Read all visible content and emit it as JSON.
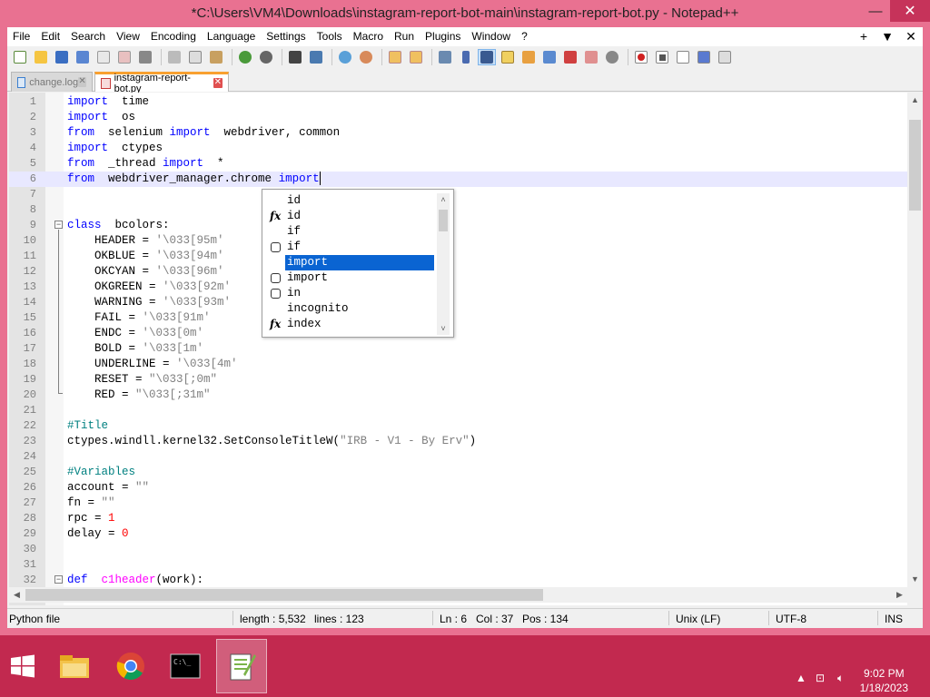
{
  "window": {
    "title": "*C:\\Users\\VM4\\Downloads\\instagram-report-bot-main\\instagram-report-bot.py - Notepad++",
    "minimize": "—",
    "close": "✕"
  },
  "menu": {
    "items": [
      "File",
      "Edit",
      "Search",
      "View",
      "Encoding",
      "Language",
      "Settings",
      "Tools",
      "Macro",
      "Run",
      "Plugins",
      "Window",
      "?"
    ],
    "right": [
      "+",
      "▼",
      "✕"
    ]
  },
  "toolbar": {
    "icons": [
      "new-file-icon",
      "open-file-icon",
      "save-icon",
      "save-all-icon",
      "close-icon",
      "close-all-icon",
      "print-icon",
      "cut-icon",
      "copy-icon",
      "paste-icon",
      "undo-icon",
      "redo-icon",
      "find-icon",
      "replace-icon",
      "zoom-in-icon",
      "zoom-out-icon",
      "sync-vertical-icon",
      "sync-horizontal-icon",
      "word-wrap-icon",
      "show-all-chars-icon",
      "indent-guide-icon",
      "udl-icon",
      "doc-map-icon",
      "function-list-icon",
      "folder-workspace-icon",
      "monitor-icon",
      "record-macro-icon",
      "stop-macro-icon",
      "play-macro-icon",
      "run-macro-multiple-icon",
      "save-macro-icon"
    ]
  },
  "tabs": [
    {
      "label": "change.log",
      "active": false
    },
    {
      "label": "instagram-report-bot.py",
      "active": true
    }
  ],
  "editor": {
    "lines": [
      {
        "n": "1",
        "parts": [
          [
            "kw2",
            "import"
          ],
          [
            "",
            "  time"
          ]
        ]
      },
      {
        "n": "2",
        "parts": [
          [
            "kw2",
            "import"
          ],
          [
            "",
            "  os"
          ]
        ]
      },
      {
        "n": "3",
        "parts": [
          [
            "kw2",
            "from"
          ],
          [
            "",
            "  selenium "
          ],
          [
            "kw2",
            "import"
          ],
          [
            "",
            "  webdriver, common"
          ]
        ]
      },
      {
        "n": "4",
        "parts": [
          [
            "kw2",
            "import"
          ],
          [
            "",
            "  ctypes"
          ]
        ]
      },
      {
        "n": "5",
        "parts": [
          [
            "kw2",
            "from"
          ],
          [
            "",
            "  _thread "
          ],
          [
            "kw2",
            "import"
          ],
          [
            "",
            "  *"
          ]
        ]
      },
      {
        "n": "6",
        "parts": [
          [
            "kw2",
            "from"
          ],
          [
            "",
            "  webdriver_manager.chrome "
          ],
          [
            "kw2",
            "import"
          ]
        ]
      },
      {
        "n": "7",
        "parts": []
      },
      {
        "n": "8",
        "parts": []
      },
      {
        "n": "9",
        "parts": [
          [
            "kw2",
            "class"
          ],
          [
            "",
            "  bcolors:"
          ]
        ]
      },
      {
        "n": "10",
        "parts": [
          [
            "",
            "    HEADER = "
          ],
          [
            "str",
            "'\\033[95m'"
          ]
        ]
      },
      {
        "n": "11",
        "parts": [
          [
            "",
            "    OKBLUE = "
          ],
          [
            "str",
            "'\\033[94m'"
          ]
        ]
      },
      {
        "n": "12",
        "parts": [
          [
            "",
            "    OKCYAN = "
          ],
          [
            "str",
            "'\\033[96m'"
          ]
        ]
      },
      {
        "n": "13",
        "parts": [
          [
            "",
            "    OKGREEN = "
          ],
          [
            "str",
            "'\\033[92m'"
          ]
        ]
      },
      {
        "n": "14",
        "parts": [
          [
            "",
            "    WARNING = "
          ],
          [
            "str",
            "'\\033[93m'"
          ]
        ]
      },
      {
        "n": "15",
        "parts": [
          [
            "",
            "    FAIL = "
          ],
          [
            "str",
            "'\\033[91m'"
          ]
        ]
      },
      {
        "n": "16",
        "parts": [
          [
            "",
            "    ENDC = "
          ],
          [
            "str",
            "'\\033[0m'"
          ]
        ]
      },
      {
        "n": "17",
        "parts": [
          [
            "",
            "    BOLD = "
          ],
          [
            "str",
            "'\\033[1m'"
          ]
        ]
      },
      {
        "n": "18",
        "parts": [
          [
            "",
            "    UNDERLINE = "
          ],
          [
            "str",
            "'\\033[4m'"
          ]
        ]
      },
      {
        "n": "19",
        "parts": [
          [
            "",
            "    RESET = "
          ],
          [
            "str",
            "\"\\033[;0m\""
          ]
        ]
      },
      {
        "n": "20",
        "parts": [
          [
            "",
            "    RED = "
          ],
          [
            "str",
            "\"\\033[;31m\""
          ]
        ]
      },
      {
        "n": "21",
        "parts": []
      },
      {
        "n": "22",
        "parts": [
          [
            "cm",
            "#Title"
          ]
        ]
      },
      {
        "n": "23",
        "parts": [
          [
            "",
            "ctypes.windll.kernel32.SetConsoleTitleW("
          ],
          [
            "str",
            "\"IRB - V1 - By Erv\""
          ],
          [
            "",
            ")"
          ]
        ]
      },
      {
        "n": "24",
        "parts": []
      },
      {
        "n": "25",
        "parts": [
          [
            "cm",
            "#Variables"
          ]
        ]
      },
      {
        "n": "26",
        "parts": [
          [
            "",
            "account = "
          ],
          [
            "str",
            "\"\""
          ]
        ]
      },
      {
        "n": "27",
        "parts": [
          [
            "",
            "fn = "
          ],
          [
            "str",
            "\"\""
          ]
        ]
      },
      {
        "n": "28",
        "parts": [
          [
            "",
            "rpc = "
          ],
          [
            "num",
            "1"
          ]
        ]
      },
      {
        "n": "29",
        "parts": [
          [
            "",
            "delay = "
          ],
          [
            "num",
            "0"
          ]
        ]
      },
      {
        "n": "30",
        "parts": []
      },
      {
        "n": "31",
        "parts": []
      },
      {
        "n": "32",
        "parts": [
          [
            "kw2",
            "def"
          ],
          [
            "fn",
            "  c1header"
          ],
          [
            "",
            "(work):"
          ]
        ]
      }
    ]
  },
  "autocomplete": {
    "items": [
      {
        "label": "id",
        "icon": ""
      },
      {
        "label": "id",
        "icon": "function-icon"
      },
      {
        "label": "if",
        "icon": ""
      },
      {
        "label": "if",
        "icon": "keyword-cube-icon"
      },
      {
        "label": "import",
        "icon": "",
        "selected": true
      },
      {
        "label": "import",
        "icon": "keyword-cube-icon"
      },
      {
        "label": "in",
        "icon": "keyword-cube-icon"
      },
      {
        "label": "incognito",
        "icon": ""
      },
      {
        "label": "index",
        "icon": "function-icon"
      }
    ]
  },
  "status": {
    "filetype": "Python file",
    "length": "length : 5,532",
    "lines": "lines : 123",
    "ln": "Ln : 6",
    "col": "Col : 37",
    "pos": "Pos : 134",
    "eol": "Unix (LF)",
    "encoding": "UTF-8",
    "mode": "INS"
  },
  "taskbar": {
    "apps": [
      "file-explorer-icon",
      "chrome-icon",
      "cmd-icon",
      "notepadpp-icon"
    ],
    "time": "9:02 PM",
    "date": "1/18/2023"
  },
  "colors": {
    "frame": "#e97191",
    "taskbar": "#c2294f",
    "selection": "#0a64d2",
    "keyword": "#0000ff"
  }
}
